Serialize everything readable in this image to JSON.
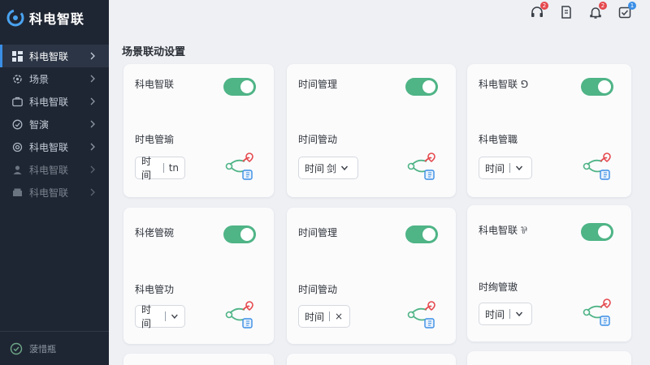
{
  "brand": {
    "name": "科电智联"
  },
  "nav": {
    "items": [
      {
        "label": "科电智联",
        "icon": "dashboard-icon",
        "active": true
      },
      {
        "label": "场景",
        "icon": "settings-icon",
        "active": false
      },
      {
        "label": "科电智联",
        "icon": "briefcase-icon",
        "active": false
      },
      {
        "label": "智演",
        "icon": "clock-icon",
        "active": false
      },
      {
        "label": "科电智联",
        "icon": "link-icon",
        "active": false
      },
      {
        "label": "科电智联",
        "icon": "user-icon",
        "active": false
      },
      {
        "label": "科电智联",
        "icon": "box-icon",
        "active": false
      }
    ]
  },
  "footer": {
    "label": "菠惜瓶"
  },
  "topbar": {
    "badges": {
      "headset": "2",
      "alerts": "2",
      "tasks": "1"
    }
  },
  "page": {
    "title": "场景联动设置"
  },
  "cards": [
    {
      "title": "科电智联",
      "subtitle": "时电管瑜",
      "select": "时间",
      "select_glyph": "tn",
      "toggle_on": true
    },
    {
      "title": "时间管理",
      "subtitle": "时间管动",
      "select": "时间",
      "select_glyph": "剑",
      "toggle_on": true
    },
    {
      "title": "科电智联 ⅁",
      "subtitle": "科电管職",
      "select": "时间",
      "select_glyph": "∨",
      "toggle_on": true
    },
    {
      "title": "科佬管碗",
      "subtitle": "科电管功",
      "select": "时间",
      "select_glyph": "∨",
      "toggle_on": true
    },
    {
      "title": "时间管理",
      "subtitle": "时间管动",
      "select": "时间",
      "select_glyph": "×",
      "toggle_on": true
    },
    {
      "title": "科电智联 ⅌",
      "subtitle": "时绚管璈",
      "select": "时间",
      "select_glyph": "∨",
      "toggle_on": true
    }
  ],
  "colors": {
    "sidebar": "#1f2633",
    "accent": "#3a8ee6",
    "toggle": "#4fb486",
    "badge": "#e5484d",
    "badge_blue": "#3a8ee6"
  }
}
